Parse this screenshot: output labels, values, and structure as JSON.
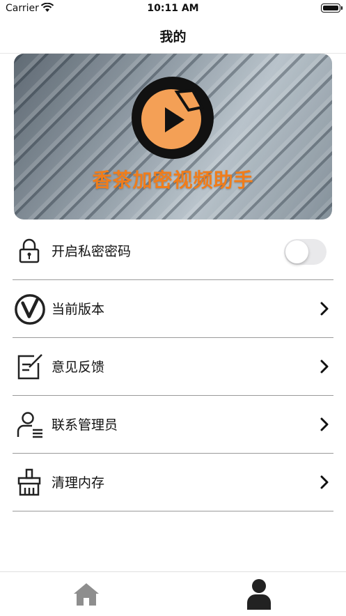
{
  "status_bar": {
    "carrier": "Carrier",
    "time": "10:11 AM"
  },
  "nav": {
    "title": "我的"
  },
  "banner": {
    "title": "香茶加密视频助手",
    "title_color": "#f07d1b",
    "logo_color": "#f4a056"
  },
  "menu": {
    "items": [
      {
        "label": "开启私密密码",
        "icon": "lock-icon",
        "control": "toggle",
        "toggle_on": false
      },
      {
        "label": "当前版本",
        "icon": "version-icon",
        "control": "chevron"
      },
      {
        "label": "意见反馈",
        "icon": "feedback-icon",
        "control": "chevron"
      },
      {
        "label": "联系管理员",
        "icon": "admin-icon",
        "control": "chevron"
      },
      {
        "label": "清理内存",
        "icon": "broom-icon",
        "control": "chevron"
      }
    ]
  },
  "tab_bar": {
    "tabs": [
      {
        "icon": "home-icon",
        "selected": false,
        "color": "#8e8e8e"
      },
      {
        "icon": "profile-icon",
        "selected": true,
        "color": "#222222"
      }
    ]
  }
}
